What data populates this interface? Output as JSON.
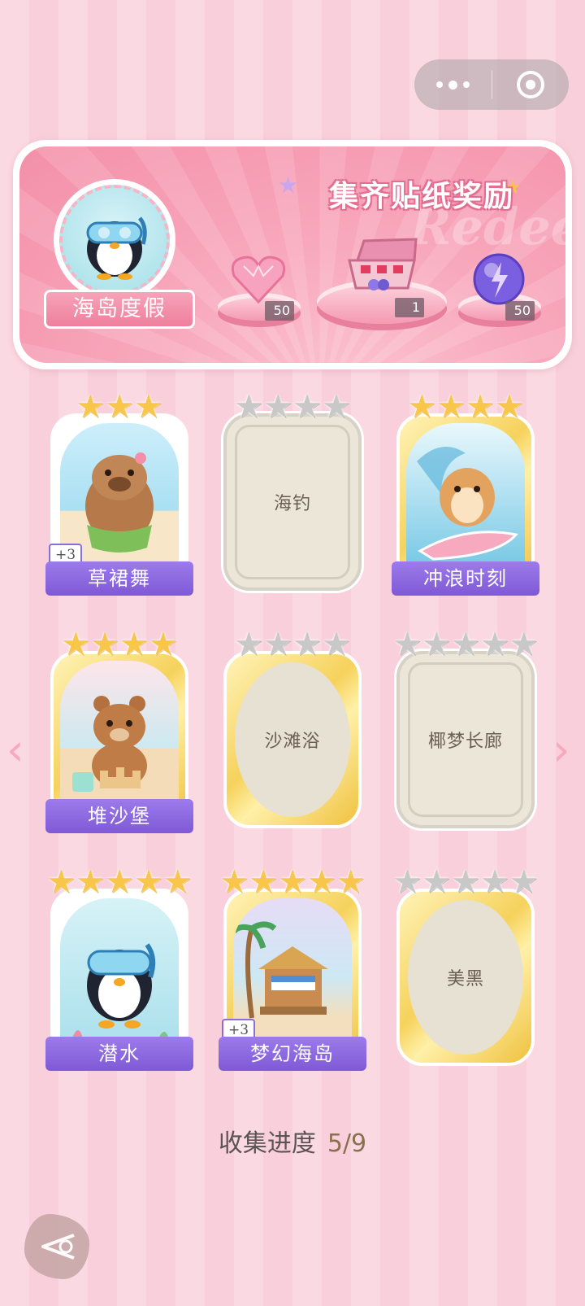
{
  "header": {
    "title": "集齐贴纸奖励",
    "watermark": "Redeem",
    "theme_label": "海岛度假",
    "rewards": [
      {
        "icon": "heart-gem-icon",
        "count": "50"
      },
      {
        "icon": "gift-box-icon",
        "count": "1"
      },
      {
        "icon": "energy-orb-icon",
        "count": "50"
      }
    ]
  },
  "cards": [
    {
      "name": "草裙舞",
      "stars": 3,
      "max_stars": 3,
      "collected": true,
      "bonus": "+3",
      "art": "capybara-hula"
    },
    {
      "name": "海钓",
      "stars": 0,
      "max_stars": 4,
      "collected": false,
      "frame": "plain"
    },
    {
      "name": "冲浪时刻",
      "stars": 4,
      "max_stars": 4,
      "collected": true,
      "art": "hamster-surfing"
    },
    {
      "name": "堆沙堡",
      "stars": 4,
      "max_stars": 4,
      "collected": true,
      "art": "bear-sandcastle"
    },
    {
      "name": "沙滩浴",
      "stars": 0,
      "max_stars": 4,
      "collected": false,
      "frame": "gold"
    },
    {
      "name": "椰梦长廊",
      "stars": 0,
      "max_stars": 5,
      "collected": false,
      "frame": "plain"
    },
    {
      "name": "潜水",
      "stars": 5,
      "max_stars": 5,
      "collected": true,
      "art": "penguin-diving"
    },
    {
      "name": "梦幻海岛",
      "stars": 5,
      "max_stars": 5,
      "collected": true,
      "bonus": "+3",
      "art": "beach-hut"
    },
    {
      "name": "美黑",
      "stars": 0,
      "max_stars": 5,
      "collected": false,
      "frame": "gold"
    }
  ],
  "progress": {
    "label": "收集进度",
    "value": "5/9"
  },
  "colors": {
    "accent_purple": "#8b66df",
    "pink": "#f48fa9",
    "gold": "#f6d25c"
  }
}
